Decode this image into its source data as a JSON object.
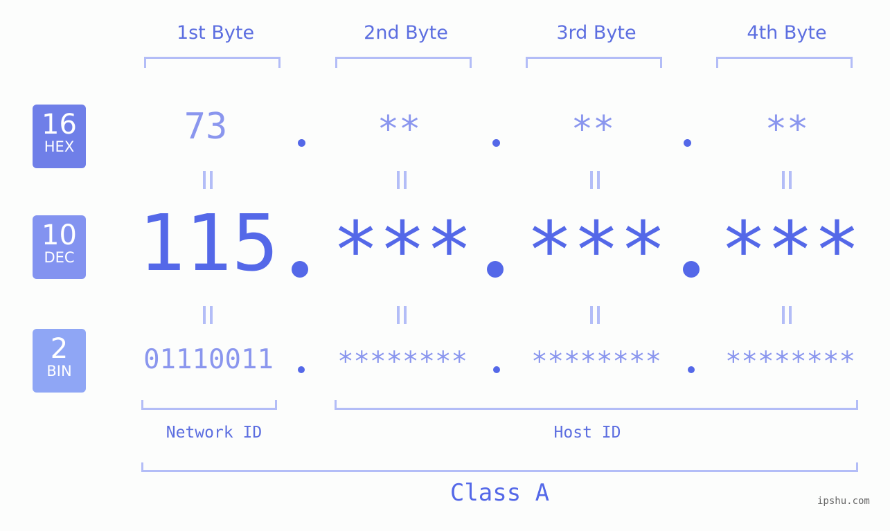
{
  "byte_headers": [
    "1st Byte",
    "2nd Byte",
    "3rd Byte",
    "4th Byte"
  ],
  "badges": [
    {
      "number": "16",
      "label": "HEX",
      "color": "#6f7fe8"
    },
    {
      "number": "10",
      "label": "DEC",
      "color": "#8393f0"
    },
    {
      "number": "2",
      "label": "BIN",
      "color": "#8fa6f5"
    }
  ],
  "hex_values": [
    "73",
    "**",
    "**",
    "**"
  ],
  "dec_values": [
    "115",
    "***",
    "***",
    "***"
  ],
  "bin_values": [
    "01110011",
    "********",
    "********",
    "********"
  ],
  "id_labels": {
    "network": "Network ID",
    "host": "Host ID"
  },
  "class_label": "Class A",
  "watermark": "ipshu.com",
  "colors": {
    "primary": "#5468e8",
    "light": "#8a96ee",
    "bracket": "#b3bdf7"
  }
}
